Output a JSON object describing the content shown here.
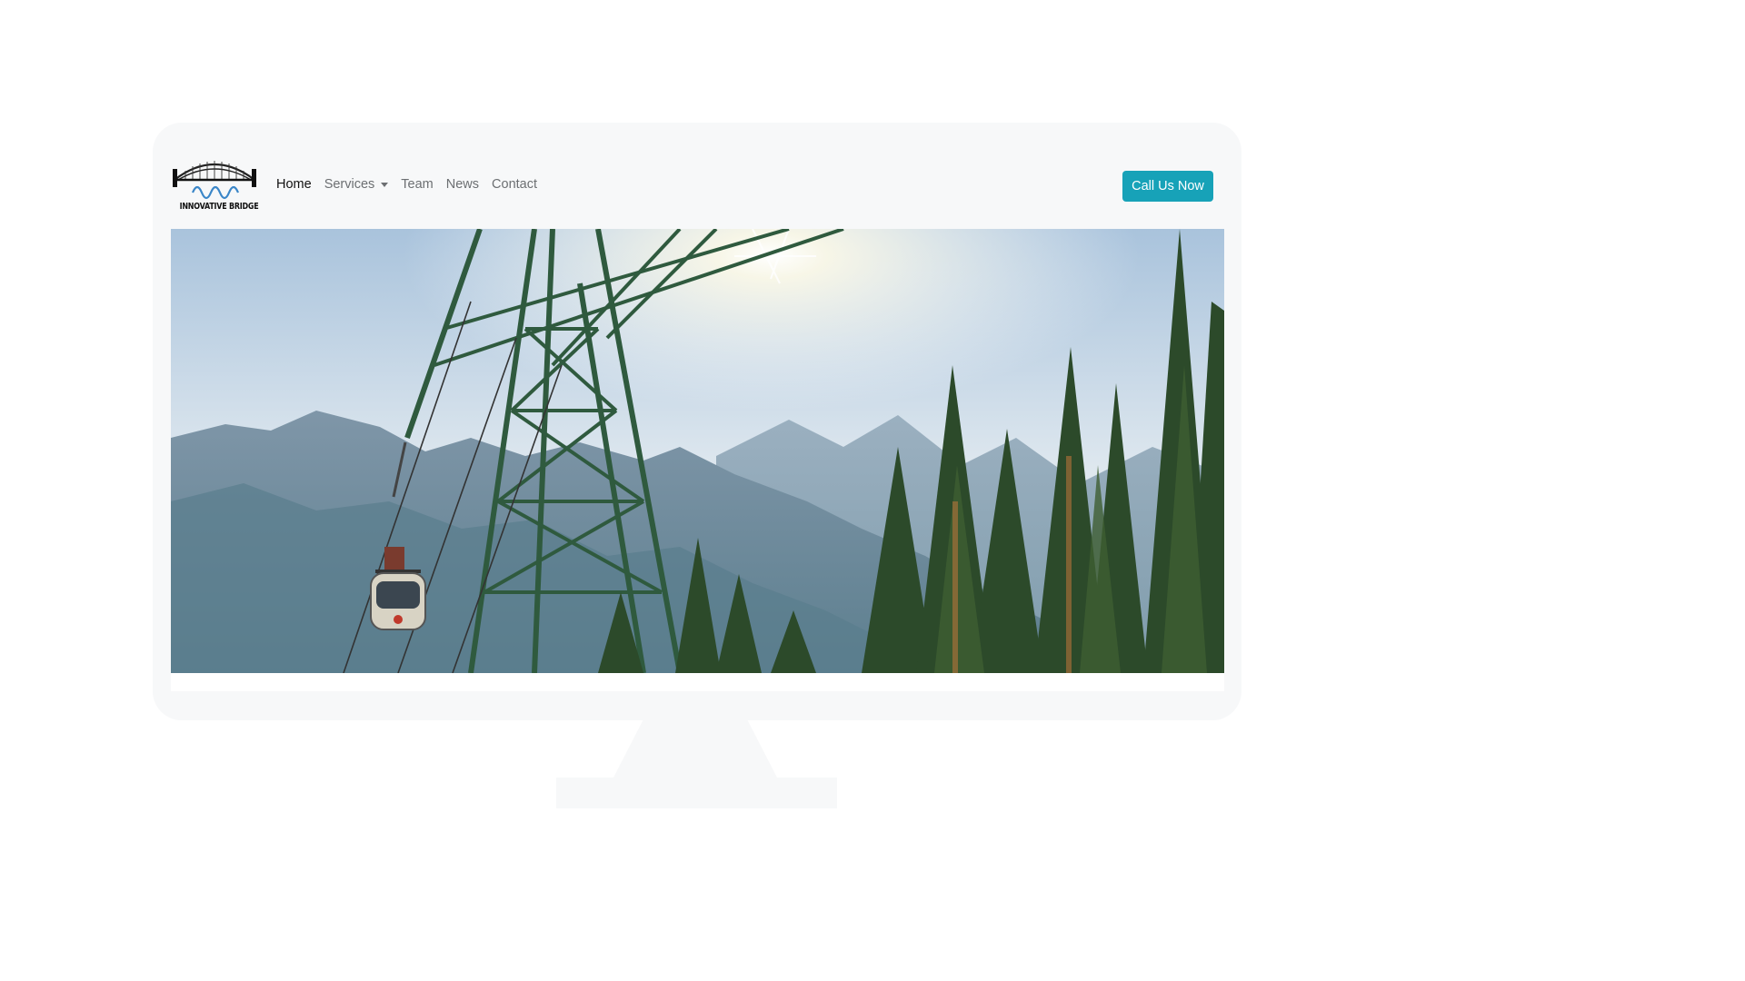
{
  "brand": {
    "name": "INNOVATIVE BRIDGE",
    "logo_icon": "bridge-logo-icon"
  },
  "nav": {
    "items": [
      {
        "label": "Home",
        "active": true
      },
      {
        "label": "Services",
        "dropdown": true
      },
      {
        "label": "Team"
      },
      {
        "label": "News"
      },
      {
        "label": "Contact"
      }
    ]
  },
  "cta": {
    "label": "Call Us Now",
    "color": "#17a2b8"
  },
  "hero": {
    "image": "gondola-mountain-forest-photo"
  }
}
